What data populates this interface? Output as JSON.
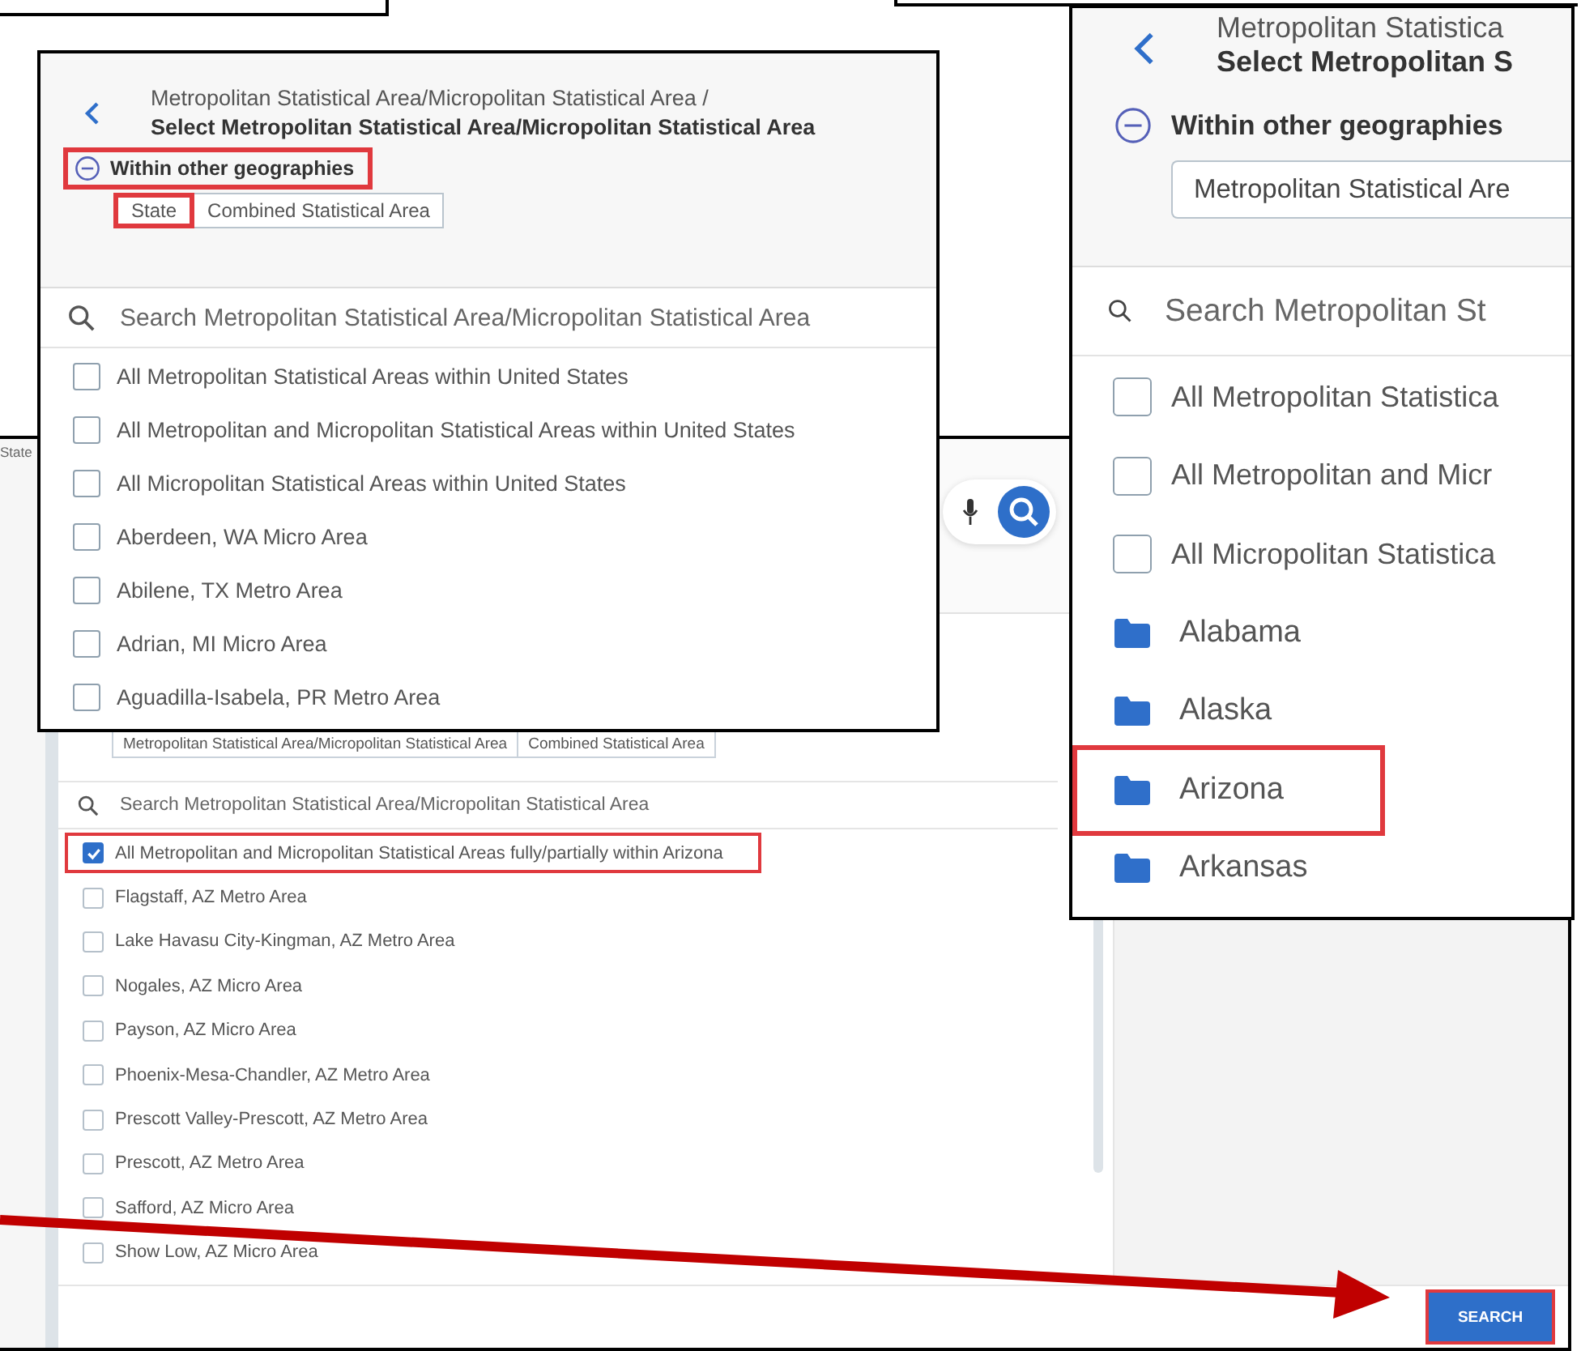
{
  "back_screen": {
    "sidebar_label": "State",
    "tags": [
      {
        "label": "Metropolitan Statistical Area/Micropolitan Statistical Area"
      },
      {
        "label": "Combined Statistical Area"
      }
    ],
    "search": {
      "placeholder": "Search Metropolitan Statistical Area/Micropolitan Statistical Area"
    },
    "items": [
      {
        "label": "All Metropolitan and Micropolitan Statistical Areas fully/partially within Arizona",
        "checked": true,
        "highlighted": true
      },
      {
        "label": "Flagstaff, AZ Metro Area",
        "checked": false,
        "highlighted": false
      },
      {
        "label": "Lake Havasu City-Kingman, AZ Metro Area",
        "checked": false,
        "highlighted": false
      },
      {
        "label": "Nogales, AZ Micro Area",
        "checked": false,
        "highlighted": false
      },
      {
        "label": "Payson, AZ Micro Area",
        "checked": false,
        "highlighted": false
      },
      {
        "label": "Phoenix-Mesa-Chandler, AZ Metro Area",
        "checked": false,
        "highlighted": false
      },
      {
        "label": "Prescott Valley-Prescott, AZ Metro Area",
        "checked": false,
        "highlighted": false
      },
      {
        "label": "Prescott, AZ Metro Area",
        "checked": false,
        "highlighted": false
      },
      {
        "label": "Safford, AZ Micro Area",
        "checked": false,
        "highlighted": false
      },
      {
        "label": "Show Low, AZ Micro Area",
        "checked": false,
        "highlighted": false
      }
    ],
    "search_button": {
      "label": "SEARCH",
      "highlighted": true
    }
  },
  "zoom_left": {
    "breadcrumb": "Metropolitan Statistical Area/Micropolitan Statistical Area /",
    "title": "Select Metropolitan Statistical Area/Micropolitan Statistical Area",
    "toggle": {
      "label": "Within other geographies",
      "expanded": true,
      "highlighted": true
    },
    "tags": [
      {
        "label": "State",
        "highlighted": true
      },
      {
        "label": "Combined Statistical Area",
        "highlighted": false
      }
    ],
    "search": {
      "placeholder": "Search Metropolitan Statistical Area/Micropolitan Statistical Area"
    },
    "items": [
      {
        "label": "All Metropolitan Statistical Areas within United States",
        "checked": false
      },
      {
        "label": "All Metropolitan and Micropolitan Statistical Areas within United States",
        "checked": false
      },
      {
        "label": "All Micropolitan Statistical Areas within United States",
        "checked": false
      },
      {
        "label": "Aberdeen, WA Micro Area",
        "checked": false
      },
      {
        "label": "Abilene, TX Metro Area",
        "checked": false
      },
      {
        "label": "Adrian, MI Micro Area",
        "checked": false
      },
      {
        "label": "Aguadilla-Isabela, PR Metro Area",
        "checked": false
      }
    ]
  },
  "zoom_right": {
    "breadcrumb": "Metropolitan Statistica",
    "title": "Select Metropolitan S",
    "toggle": {
      "label": "Within other geographies",
      "expanded": true,
      "highlighted": false
    },
    "geography_field": {
      "value": "Metropolitan Statistical Are"
    },
    "search": {
      "placeholder": "Search Metropolitan St"
    },
    "items": [
      {
        "kind": "checkbox",
        "label": "All Metropolitan Statistica",
        "checked": false
      },
      {
        "kind": "checkbox",
        "label": "All Metropolitan and Micr",
        "checked": false
      },
      {
        "kind": "checkbox",
        "label": "All Micropolitan Statistica",
        "checked": false
      },
      {
        "kind": "folder",
        "label": "Alabama",
        "highlighted": false
      },
      {
        "kind": "folder",
        "label": "Alaska",
        "highlighted": false
      },
      {
        "kind": "folder",
        "label": "Arizona",
        "highlighted": true
      },
      {
        "kind": "folder",
        "label": "Arkansas",
        "highlighted": false
      }
    ]
  }
}
